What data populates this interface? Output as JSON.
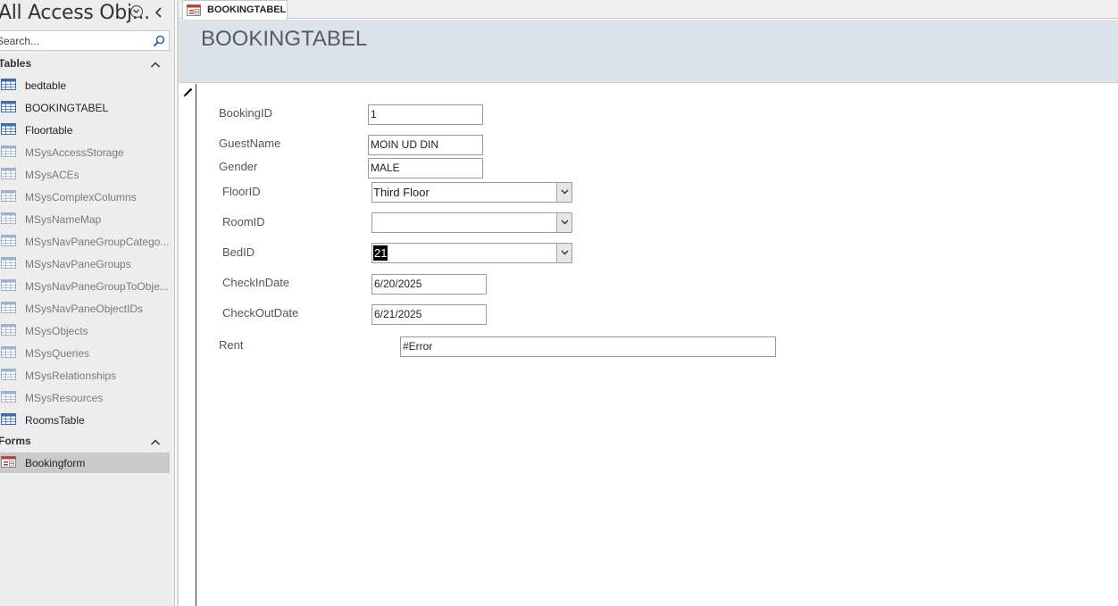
{
  "nav": {
    "title": "All Access Obj...",
    "search_placeholder": "Search...",
    "groups": [
      {
        "label": "Tables",
        "items": [
          {
            "label": "bedtable",
            "icon": "table-icon",
            "system": false
          },
          {
            "label": "BOOKINGTABEL",
            "icon": "table-icon",
            "system": false
          },
          {
            "label": "Floortable",
            "icon": "table-icon",
            "system": false
          },
          {
            "label": "MSysAccessStorage",
            "icon": "table-icon",
            "system": true
          },
          {
            "label": "MSysACEs",
            "icon": "table-icon",
            "system": true
          },
          {
            "label": "MSysComplexColumns",
            "icon": "table-icon",
            "system": true
          },
          {
            "label": "MSysNameMap",
            "icon": "table-icon",
            "system": true
          },
          {
            "label": "MSysNavPaneGroupCatego...",
            "icon": "table-icon",
            "system": true
          },
          {
            "label": "MSysNavPaneGroups",
            "icon": "table-icon",
            "system": true
          },
          {
            "label": "MSysNavPaneGroupToObje...",
            "icon": "table-icon",
            "system": true
          },
          {
            "label": "MSysNavPaneObjectIDs",
            "icon": "table-icon",
            "system": true
          },
          {
            "label": "MSysObjects",
            "icon": "table-icon",
            "system": true
          },
          {
            "label": "MSysQueries",
            "icon": "table-icon",
            "system": true
          },
          {
            "label": "MSysRelationships",
            "icon": "table-icon",
            "system": true
          },
          {
            "label": "MSysResources",
            "icon": "table-icon",
            "system": true
          },
          {
            "label": "RoomsTable",
            "icon": "table-icon",
            "system": false
          }
        ]
      },
      {
        "label": "Forms",
        "items": [
          {
            "label": "Bookingform",
            "icon": "form-icon",
            "system": false,
            "selected": true
          }
        ]
      }
    ]
  },
  "tab": {
    "label": "BOOKINGTABEL",
    "icon": "form-icon"
  },
  "form": {
    "title": "BOOKINGTABEL",
    "fields": {
      "booking_id": {
        "label": "BookingID",
        "value": "1"
      },
      "guest_name": {
        "label": "GuestName",
        "value": "MOIN UD DIN"
      },
      "gender": {
        "label": "Gender",
        "value": "MALE"
      },
      "floor_id": {
        "label": "FloorID",
        "value": "Third Floor"
      },
      "room_id": {
        "label": "RoomID",
        "value": ""
      },
      "bed_id": {
        "label": "BedID",
        "value": "21"
      },
      "check_in": {
        "label": "CheckInDate",
        "value": "6/20/2025"
      },
      "check_out": {
        "label": "CheckOutDate",
        "value": "6/21/2025"
      },
      "rent": {
        "label": "Rent",
        "value": "#Error"
      }
    }
  },
  "colors": {
    "nav_bg": "#ededed",
    "header_bg": "#dce2ea",
    "selected_item_bg": "#c9c9c9",
    "table_icon_blue": "#3b6cb5",
    "form_icon_red": "#c0392b"
  }
}
